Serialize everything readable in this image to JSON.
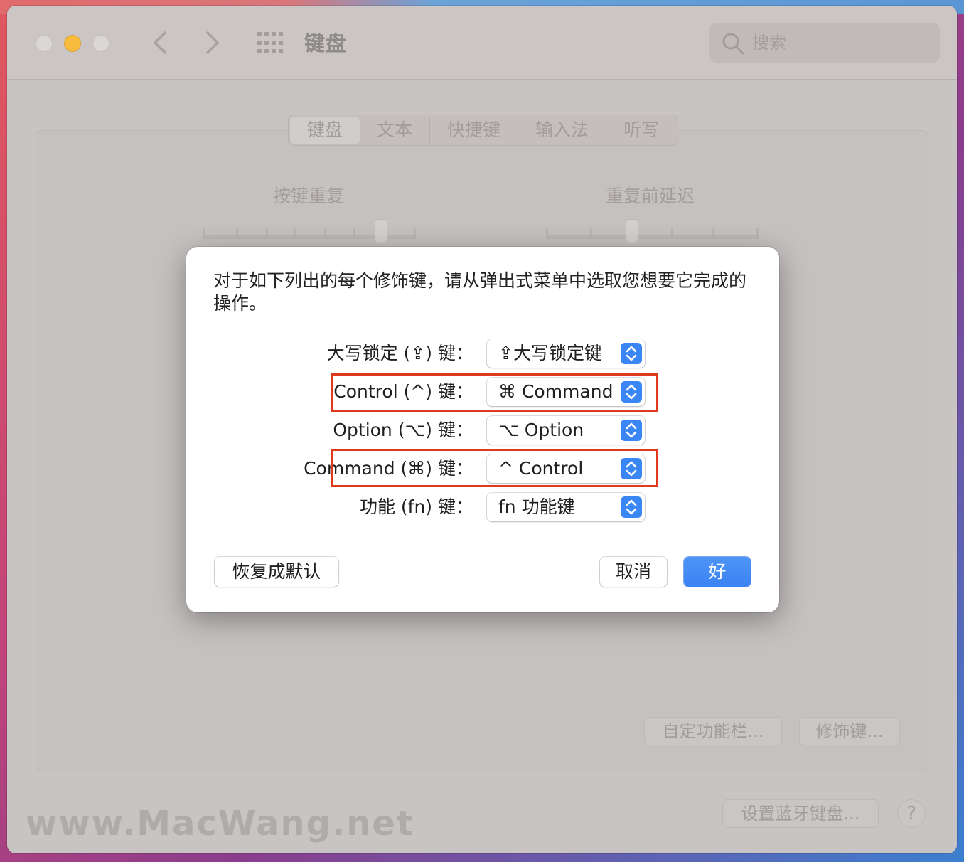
{
  "window": {
    "title": "键盘",
    "search_placeholder": "搜索"
  },
  "tabs": [
    {
      "label": "键盘",
      "active": true
    },
    {
      "label": "文本",
      "active": false
    },
    {
      "label": "快捷键",
      "active": false
    },
    {
      "label": "输入法",
      "active": false
    },
    {
      "label": "听写",
      "active": false
    }
  ],
  "sliders": {
    "key_repeat_label": "按键重复",
    "repeat_delay_label": "重复前延迟"
  },
  "background_buttons": {
    "customize_touchbar": "自定功能栏...",
    "modifier_keys": "修饰键...",
    "bluetooth_keyboard": "设置蓝牙键盘...",
    "help": "?"
  },
  "watermark": "www.MacWang.net",
  "dialog": {
    "message": "对于如下列出的每个修饰键，请从弹出式菜单中选取您想要它完成的操作。",
    "rows": [
      {
        "label": "大写锁定 (⇪) 键：",
        "value": "⇪大写锁定键"
      },
      {
        "label": "Control (^) 键：",
        "value": "⌘ Command"
      },
      {
        "label": "Option (⌥) 键：",
        "value": "⌥ Option"
      },
      {
        "label": "Command (⌘) 键：",
        "value": "^ Control"
      },
      {
        "label": "功能 (fn) 键：",
        "value": "fn 功能键"
      }
    ],
    "restore_defaults": "恢复成默认",
    "cancel": "取消",
    "ok": "好"
  },
  "colors": {
    "accent": "#3a86f5",
    "highlight_box": "#e03a1e"
  }
}
